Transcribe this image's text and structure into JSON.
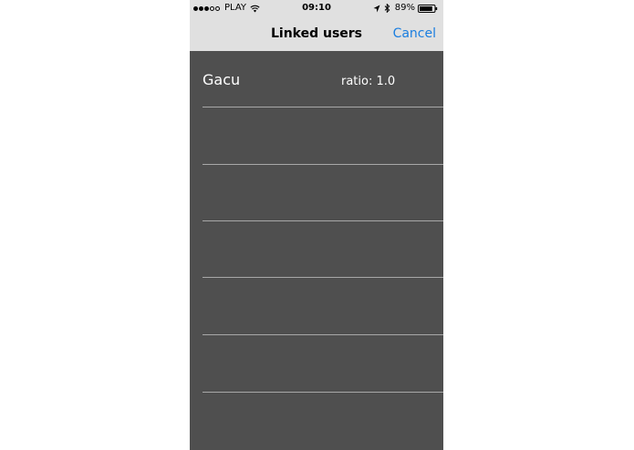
{
  "status_bar": {
    "carrier": "PLAY",
    "signal_filled": 3,
    "signal_total": 5,
    "time": "09:10",
    "battery_percent": "89%",
    "battery_level": 0.89
  },
  "nav": {
    "title": "Linked users",
    "cancel_label": "Cancel"
  },
  "list": {
    "rows": [
      {
        "name": "Gacu",
        "ratio": "ratio: 1.0"
      },
      {
        "name": "",
        "ratio": ""
      },
      {
        "name": "",
        "ratio": ""
      },
      {
        "name": "",
        "ratio": ""
      },
      {
        "name": "",
        "ratio": ""
      },
      {
        "name": "",
        "ratio": ""
      }
    ]
  },
  "colors": {
    "accent": "#1a7ee0",
    "bar_background": "#e0e0e0",
    "list_background": "#4f4f4f",
    "separator": "#a8a8a8"
  }
}
